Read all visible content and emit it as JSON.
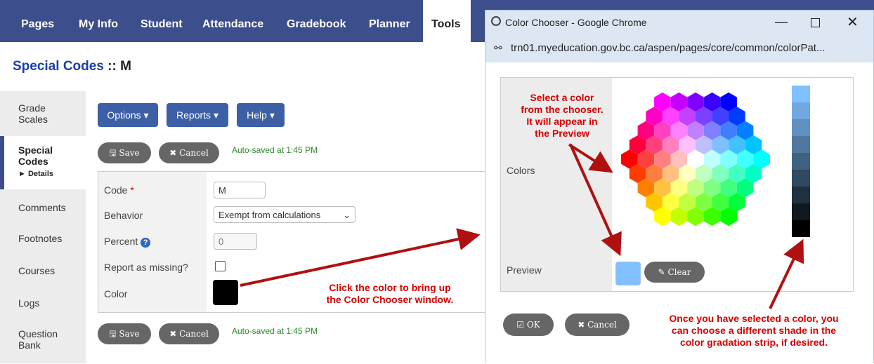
{
  "nav": {
    "tabs": [
      "Pages",
      "My Info",
      "Student",
      "Attendance",
      "Gradebook",
      "Planner",
      "Tools"
    ],
    "active": "Tools"
  },
  "page": {
    "title_main": "Special Codes",
    "title_sep": " :: ",
    "title_code": "M"
  },
  "sidebar": {
    "items": [
      {
        "label_line1": "Grade",
        "label_line2": "Scales"
      },
      {
        "label_line1": "Special",
        "label_line2": "Codes",
        "sub": "► Details"
      },
      {
        "label_line1": "Comments"
      },
      {
        "label_line1": "Footnotes"
      },
      {
        "label_line1": "Courses"
      },
      {
        "label_line1": "Logs"
      },
      {
        "label_line1": "Question",
        "label_line2": "Bank"
      }
    ]
  },
  "toolbar": {
    "options": "Options ▾",
    "reports": "Reports ▾",
    "help": "Help ▾"
  },
  "actions": {
    "save": "Save",
    "cancel": "Cancel",
    "autosave": "Auto-saved at 1:45 PM"
  },
  "form": {
    "code_label": "Code",
    "required_mark": "*",
    "code_value": "M",
    "behavior_label": "Behavior",
    "behavior_value": "Exempt from calculations",
    "percent_label": "Percent",
    "percent_value": "0",
    "missing_label": "Report as missing?",
    "color_label": "Color",
    "color_value": "#000000"
  },
  "annotations": {
    "click_color": [
      "Click the color to bring up",
      "the Color Chooser window."
    ],
    "select_color": [
      "Select a color",
      "from the chooser.",
      "It will appear in",
      "the Preview"
    ],
    "shade": [
      "Once you have selected a color, you",
      "can choose a different shade in the",
      "color gradation strip, if desired."
    ]
  },
  "window": {
    "title": "Color Chooser - Google Chrome",
    "url": "trn01.myeducation.gov.bc.ca/aspen/pages/core/common/colorPat...",
    "colors_label": "Colors",
    "preview_label": "Preview",
    "preview_color": "#80c0ff",
    "clear": "Clear",
    "ok": "OK",
    "cancel": "Cancel"
  },
  "colors": {
    "nav_bg": "#3c4f8c",
    "primary_button": "#3c5fa6",
    "arrow": "#b01010",
    "annotation_text": "#d60000",
    "autosave_text": "#2a8a2a"
  }
}
